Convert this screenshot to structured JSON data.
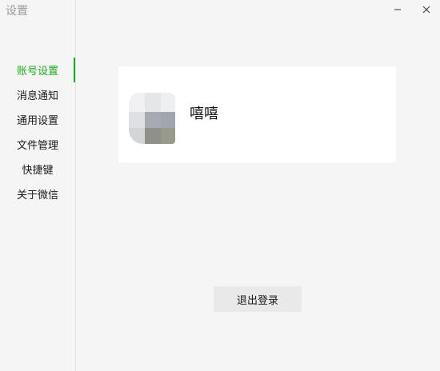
{
  "window": {
    "title": "设置",
    "minimize_icon": "minimize-icon",
    "close_icon": "close-icon"
  },
  "sidebar": {
    "active_color": "#1aad19",
    "items": [
      {
        "label": "账号设置",
        "active": true
      },
      {
        "label": "消息通知",
        "active": false
      },
      {
        "label": "通用设置",
        "active": false
      },
      {
        "label": "文件管理",
        "active": false
      },
      {
        "label": "快捷键",
        "active": false
      },
      {
        "label": "关于微信",
        "active": false
      }
    ]
  },
  "profile": {
    "avatar_icon": "pixelated-avatar",
    "nickname": "嘻嘻"
  },
  "actions": {
    "logout_label": "退出登录"
  }
}
